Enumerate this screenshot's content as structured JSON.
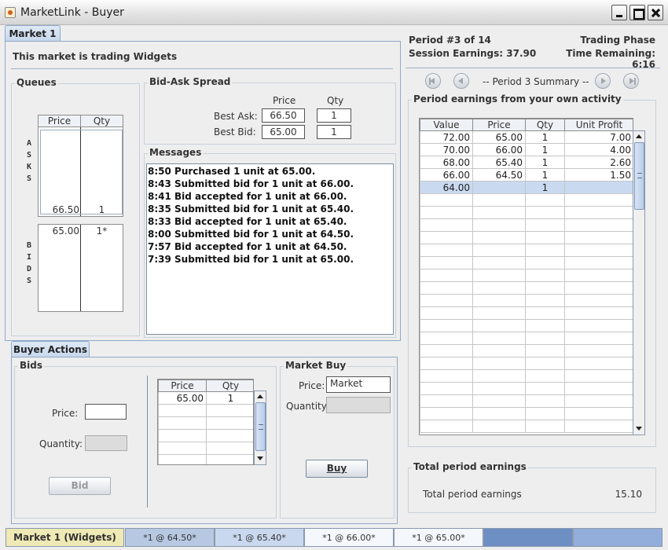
{
  "window": {
    "title": "MarketLink - Buyer"
  },
  "tabs": {
    "market": "Market 1",
    "buyer_actions": "Buyer Actions"
  },
  "market": {
    "trading_label": "This market is trading Widgets",
    "queues": {
      "title": "Queues",
      "col_price": "Price",
      "col_qty": "Qty",
      "asks_label": "ASKS",
      "bids_label": "BIDS",
      "asks": [
        {
          "price": "66.50",
          "qty": "1"
        }
      ],
      "bids": [
        {
          "price": "65.00",
          "qty": "1*"
        }
      ]
    },
    "spread": {
      "title": "Bid-Ask Spread",
      "col_price": "Price",
      "col_qty": "Qty",
      "best_ask_label": "Best Ask:",
      "best_ask_price": "66.50",
      "best_ask_qty": "1",
      "best_bid_label": "Best Bid:",
      "best_bid_price": "65.00",
      "best_bid_qty": "1"
    },
    "messages": {
      "title": "Messages",
      "lines": [
        "8:50 Purchased 1 unit at 65.00.",
        "8:43 Submitted bid for 1 unit at 66.00.",
        "8:41 Bid accepted for 1 unit at 66.00.",
        "8:35 Submitted bid for 1 unit at 65.40.",
        "8:33 Bid accepted for 1 unit at 65.40.",
        "8:00 Submitted bid for 1 unit at 64.50.",
        "7:57 Bid accepted for 1 unit at 64.50.",
        "7:39 Submitted bid for 1 unit at 65.00."
      ]
    }
  },
  "buyer_actions": {
    "bids": {
      "title": "Bids",
      "price_label": "Price:",
      "price_value": "",
      "quantity_label": "Quantity:",
      "quantity_value": "",
      "bid_button": "Bid",
      "col_price": "Price",
      "col_qty": "Qty",
      "rows": [
        {
          "price": "65.00",
          "qty": "1"
        }
      ]
    },
    "market_buy": {
      "title": "Market Buy",
      "price_label": "Price:",
      "price_value": "Market",
      "quantity_label": "Quantity:",
      "quantity_value": "",
      "buy_button": "Buy"
    }
  },
  "period": {
    "period_text": "Period #3 of 14",
    "phase": "Trading Phase",
    "session_earnings": "Session Earnings: 37.90",
    "time_remaining": "Time Remaining: 6:16",
    "summary_label": "-- Period 3 Summary --"
  },
  "earnings": {
    "title": "Period earnings from your own activity",
    "columns": [
      "Value",
      "Price",
      "Qty",
      "Unit Profit"
    ],
    "rows": [
      {
        "value": "72.00",
        "price": "65.00",
        "qty": "1",
        "profit": "7.00"
      },
      {
        "value": "70.00",
        "price": "66.00",
        "qty": "1",
        "profit": "4.00"
      },
      {
        "value": "68.00",
        "price": "65.40",
        "qty": "1",
        "profit": "2.60"
      },
      {
        "value": "66.00",
        "price": "64.50",
        "qty": "1",
        "profit": "1.50"
      },
      {
        "value": "64.00",
        "price": "",
        "qty": "1",
        "profit": ""
      }
    ],
    "selected_row": 4
  },
  "total": {
    "title": "Total period earnings",
    "label": "Total period earnings",
    "value": "15.10"
  },
  "status_bar": {
    "market": "Market 1 (Widgets)",
    "cells": [
      "*1 @ 64.50*",
      "*1 @ 65.40*",
      "*1 @ 66.00*",
      "*1 @ 65.00*",
      "",
      ""
    ]
  },
  "colors": {
    "market_cell": "#efe9b5",
    "cell_blue": "#b7c8e2",
    "cell_light": "#c9d8ee",
    "cell_white": "#f4f7fc",
    "cell_dark": "#6d8fc4",
    "cell_mid": "#93aedb"
  }
}
